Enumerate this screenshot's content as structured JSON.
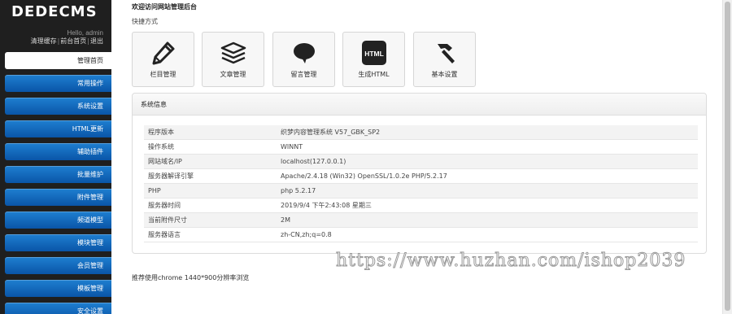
{
  "sidebar": {
    "logo": "DEDECMS",
    "hello": "Hello, admin",
    "links": [
      "清理缓存",
      "前台首页",
      "退出"
    ],
    "menu": [
      {
        "label": "管理首页",
        "active": true
      },
      {
        "label": "常用操作",
        "active": false
      },
      {
        "label": "系统设置",
        "active": false
      },
      {
        "label": "HTML更新",
        "active": false
      },
      {
        "label": "辅助插件",
        "active": false
      },
      {
        "label": "批量维护",
        "active": false
      },
      {
        "label": "附件管理",
        "active": false
      },
      {
        "label": "频道模型",
        "active": false
      },
      {
        "label": "模块管理",
        "active": false
      },
      {
        "label": "会员管理",
        "active": false
      },
      {
        "label": "模板管理",
        "active": false
      },
      {
        "label": "安全设置",
        "active": false
      }
    ]
  },
  "main": {
    "welcome": "欢迎访问网站管理后台",
    "shortcut_label": "快捷方式",
    "shortcuts": [
      {
        "label": "栏目管理",
        "icon": "pencil-icon"
      },
      {
        "label": "文章管理",
        "icon": "stack-icon"
      },
      {
        "label": "留言管理",
        "icon": "speech-bubble-icon"
      },
      {
        "label": "生成HTML",
        "icon": "html-icon",
        "icon_text": "HTML"
      },
      {
        "label": "基本设置",
        "icon": "hammer-icon"
      }
    ],
    "sysinfo": {
      "title": "系统信息",
      "rows": [
        {
          "key": "程序版本",
          "value": "织梦内容管理系统 V57_GBK_SP2"
        },
        {
          "key": "操作系统",
          "value": "WINNT"
        },
        {
          "key": "网站域名/IP",
          "value": "localhost(127.0.0.1)"
        },
        {
          "key": "服务器解译引擎",
          "value": "Apache/2.4.18 (Win32) OpenSSL/1.0.2e PHP/5.2.17"
        },
        {
          "key": "PHP",
          "value": "php 5.2.17"
        },
        {
          "key": "服务器时间",
          "value": "2019/9/4 下午2:43:08 星期三"
        },
        {
          "key": "当前附件尺寸",
          "value": "2M"
        },
        {
          "key": "服务器语言",
          "value": "zh-CN,zh;q=0.8"
        }
      ]
    },
    "footer": "推荐使用chrome 1440*900分辨率浏览"
  },
  "watermark": "https://www.huzhan.com/ishop2039",
  "colors": {
    "sidebar_bg": "#1f1f1f",
    "menu_blue": "#0a55a8",
    "accent_white": "#ffffff"
  }
}
